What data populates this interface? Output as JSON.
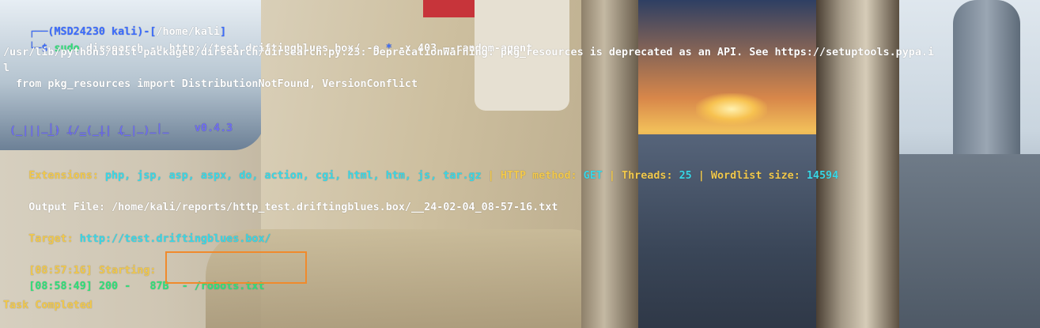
{
  "prompt": {
    "top_prefix": "┌──(",
    "user": "MSD24230 kali",
    "sep": ")-[",
    "cwd": "/home/kali",
    "close": "]",
    "bottom_prefix": "└─",
    "dollar": "$",
    "command_sudo": "sudo",
    "command_rest": "dirsearch -u http://test.driftingblues.box/ -e",
    "command_star": "*",
    "command_tail": "-x 403 --random-agent"
  },
  "warning": {
    "line1": "/usr/lib/python3/dist-packages/dirsearch/dirsearch.py:23: DeprecationWarning: pkg_resources is deprecated as an API. See https://setuptools.pypa.i",
    "line2": "l",
    "line3": "  from pkg_resources import DistributionNotFound, VersionConflict"
  },
  "banner": {
    "art1": "  _|. _ _  _  _  _ _|_    ",
    "version": "v0.4.3",
    "art2": " (_||| _) (/_(_|| (_| )"
  },
  "config": {
    "extensions_label": "Extensions:",
    "extensions": "php, jsp, asp, aspx, do, action, cgi, html, htm, js, tar.gz",
    "pipe": "|",
    "method_label": "HTTP method:",
    "method": "GET",
    "threads_label": "Threads:",
    "threads": "25",
    "wordlist_label": "Wordlist size:",
    "wordlist": "14594"
  },
  "output": {
    "label": "Output File:",
    "path": "/home/kali/reports/http_test.driftingblues.box/__24-02-04_08-57-16.txt"
  },
  "target": {
    "label": "Target:",
    "url": "http://test.driftingblues.box/"
  },
  "scan": {
    "start_time": "[08:57:16]",
    "start_label": "Starting:",
    "result_time": "[08:58:49]",
    "result_status": "200",
    "result_dash": "-",
    "result_size": "87B",
    "result_dash2": "-",
    "result_path": "/robots.txt",
    "done": "Task Completed"
  },
  "colors": {
    "prompt_blue": "#3b6cff",
    "cyan": "#39d7e7",
    "yellow": "#f2c94c",
    "green": "#2fe07a",
    "highlight_box": "#f08a2c"
  }
}
